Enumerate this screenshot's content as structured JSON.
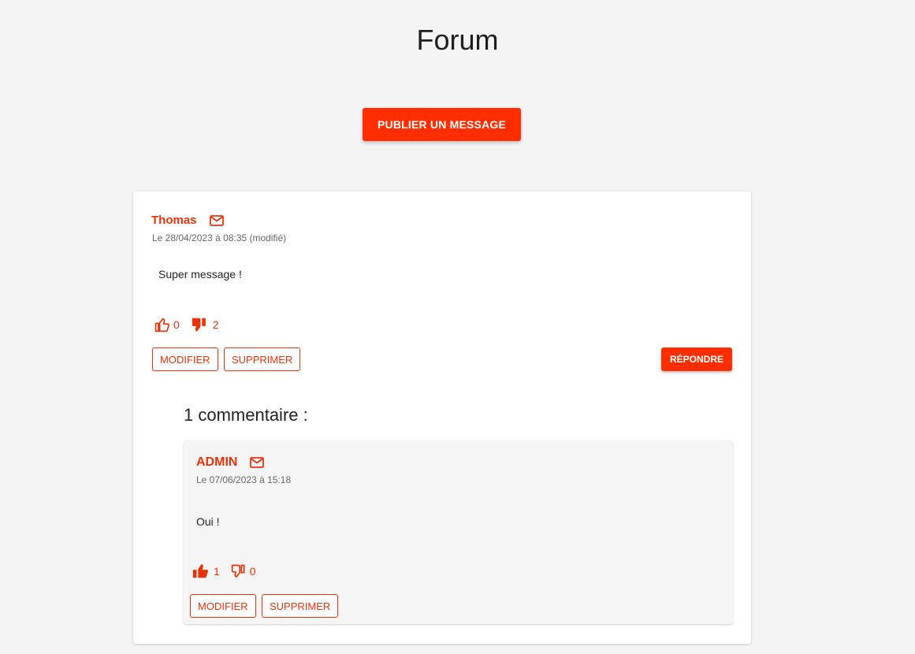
{
  "page": {
    "title": "Forum"
  },
  "actions": {
    "publish_label": "PUBLIER UN MESSAGE"
  },
  "post": {
    "author": "Thomas",
    "date": "Le 28/04/2023 à 08:35 (modifié)",
    "body": "Super message !",
    "likes": "0",
    "dislikes": "2",
    "modify_label": "MODIFIER",
    "delete_label": "SUPPRIMER",
    "reply_label": "RÉPONDRE"
  },
  "comments": {
    "heading": "1 commentaire :",
    "items": [
      {
        "author": "ADMIN",
        "date": "Le 07/06/2023 à 15:18",
        "body": "Oui !",
        "likes": "1",
        "dislikes": "0",
        "modify_label": "MODIFIER",
        "delete_label": "SUPPRIMER"
      }
    ]
  },
  "colors": {
    "accent": "#ff2d00",
    "accent_text": "#e8330a",
    "background": "#f4f4f5",
    "card": "#ffffff",
    "comment_card": "#f5f5f6"
  },
  "icons": {
    "mail": "mail-icon",
    "like_outline": "thumb-up-outline-icon",
    "like_filled": "thumb-up-filled-icon",
    "dislike_outline": "thumb-down-outline-icon",
    "dislike_filled": "thumb-down-filled-icon"
  }
}
